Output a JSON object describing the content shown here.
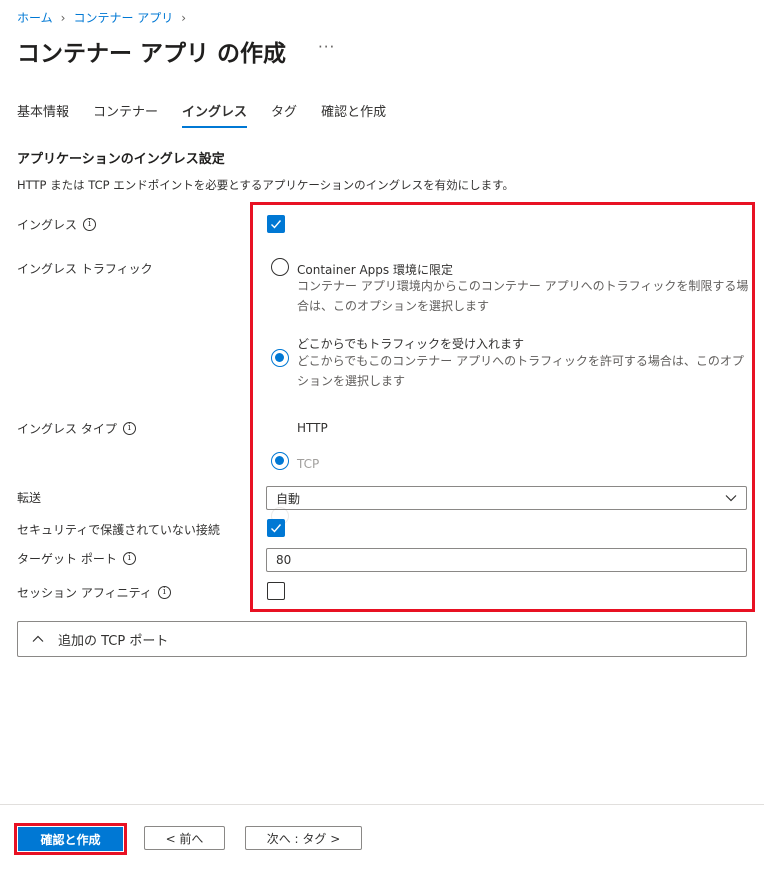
{
  "breadcrumb": {
    "home": "ホーム",
    "container_app": "コンテナー アプリ"
  },
  "page": {
    "title": "コンテナー アプリ の作成",
    "more": "···"
  },
  "tabs": [
    {
      "label": "基本情報",
      "active": false
    },
    {
      "label": "コンテナー",
      "active": false
    },
    {
      "label": "イングレス",
      "active": true
    },
    {
      "label": "タグ",
      "active": false
    },
    {
      "label": "確認と作成",
      "active": false
    }
  ],
  "section": {
    "title": "アプリケーションのイングレス設定",
    "description": "HTTP または TCP エンドポイントを必要とするアプリケーションのイングレスを有効にします。"
  },
  "fields": {
    "ingress": {
      "label": "イングレス",
      "checked": true
    },
    "traffic": {
      "label": "イングレス トラフィック",
      "option1_title": "Container Apps 環境に限定",
      "option1_desc": "コンテナー アプリ環境内からこのコンテナー アプリへのトラフィックを制限する場合は、このオプションを選択します",
      "option2_title": "どこからでもトラフィックを受け入れます",
      "option2_desc": "どこからでもこのコンテナー アプリへのトラフィックを許可する場合は、このオプションを選択します",
      "selected": "option2"
    },
    "ingress_type": {
      "label": "イングレス タイプ",
      "http": "HTTP",
      "tcp": "TCP",
      "selected": "HTTP"
    },
    "transport": {
      "label": "転送",
      "value": "自動"
    },
    "insecure": {
      "label": "セキュリティで保護されていない接続",
      "checked": true
    },
    "target_port": {
      "label": "ターゲット ポート",
      "value": "80"
    },
    "session_affinity": {
      "label": "セッション アフィニティ",
      "checked": false
    }
  },
  "accordion": {
    "label": "追加の TCP ポート"
  },
  "footer": {
    "review_create": "確認と作成",
    "previous": "< 前へ",
    "next": "次へ : タグ >"
  },
  "colors": {
    "accent": "#0078d4",
    "highlight": "#e81123"
  }
}
